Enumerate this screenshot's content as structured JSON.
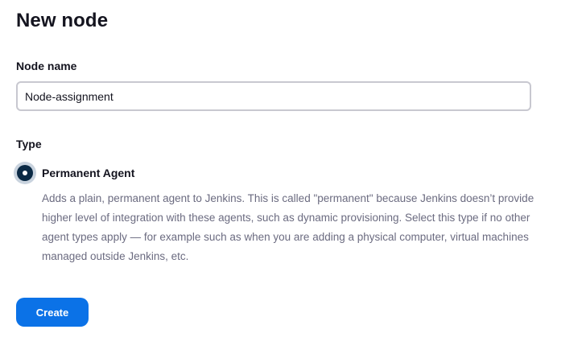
{
  "page": {
    "title": "New node"
  },
  "form": {
    "node_name_label": "Node name",
    "node_name_value": "Node-assignment",
    "type_label": "Type",
    "types": [
      {
        "label": "Permanent Agent",
        "selected": true,
        "description": "Adds a plain, permanent agent to Jenkins. This is called \"permanent\" because Jenkins doesn’t provide higher level of integration with these agents, such as dynamic provisioning. Select this type if no other agent types apply — for example such as when you are adding a physical computer, virtual machines managed outside Jenkins, etc."
      }
    ],
    "create_label": "Create"
  },
  "colors": {
    "primary_button": "#0b72e7",
    "radio_selected": "#0b2a45",
    "description_text": "#6b6b80"
  }
}
